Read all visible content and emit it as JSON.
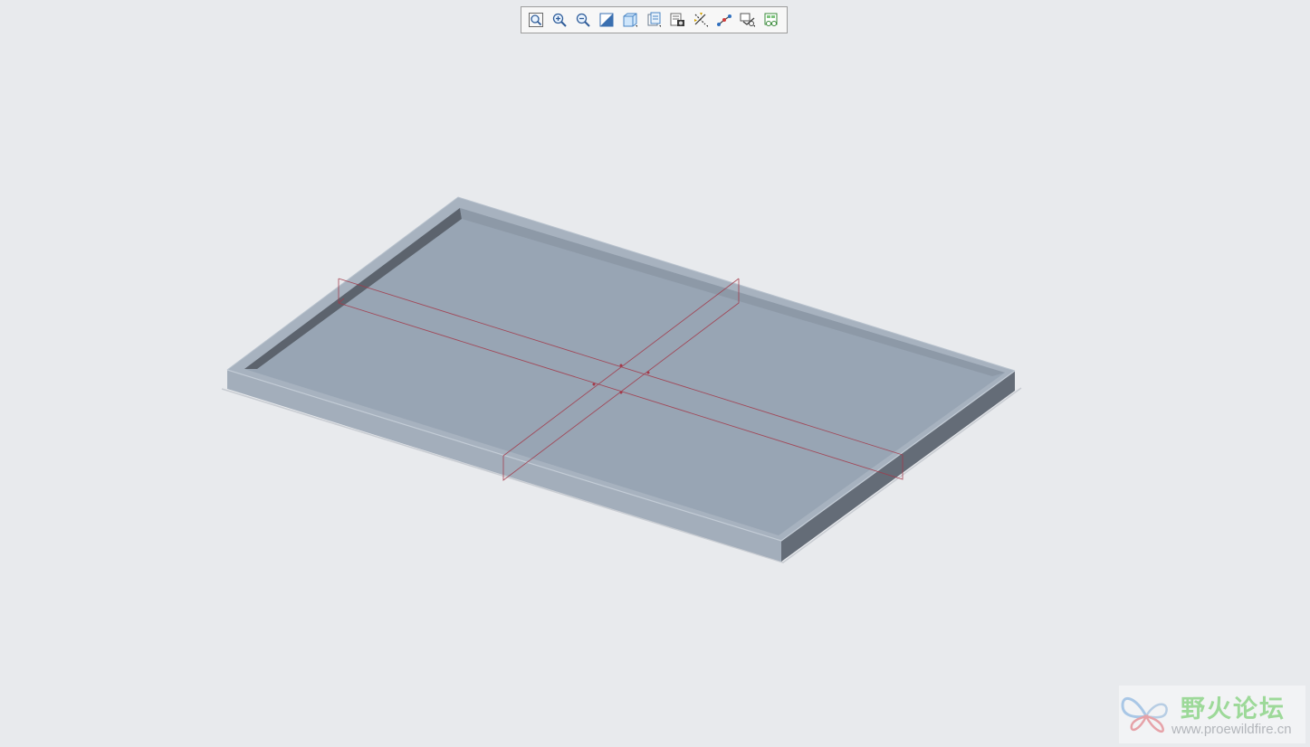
{
  "toolbar": {
    "buttons": [
      {
        "icon": "refit-icon"
      },
      {
        "icon": "zoom-in-icon"
      },
      {
        "icon": "zoom-out-icon"
      },
      {
        "icon": "repaint-icon"
      },
      {
        "icon": "display-style-icon"
      },
      {
        "icon": "saved-orientations-icon"
      },
      {
        "icon": "view-manager-icon"
      },
      {
        "icon": "datum-display-filters-icon"
      },
      {
        "icon": "annotation-display-icon"
      },
      {
        "icon": "spin-center-icon"
      },
      {
        "icon": "appearance-gallery-icon"
      }
    ]
  },
  "colors": {
    "background": "#e8eaed",
    "part_top": "#99a6b5",
    "part_front": "#a2adba",
    "part_side": "#646c77",
    "datum_plane": "#a33a4a"
  },
  "watermark": {
    "brand_cn": "野火论坛",
    "url": "www.proewildfire.cn"
  }
}
